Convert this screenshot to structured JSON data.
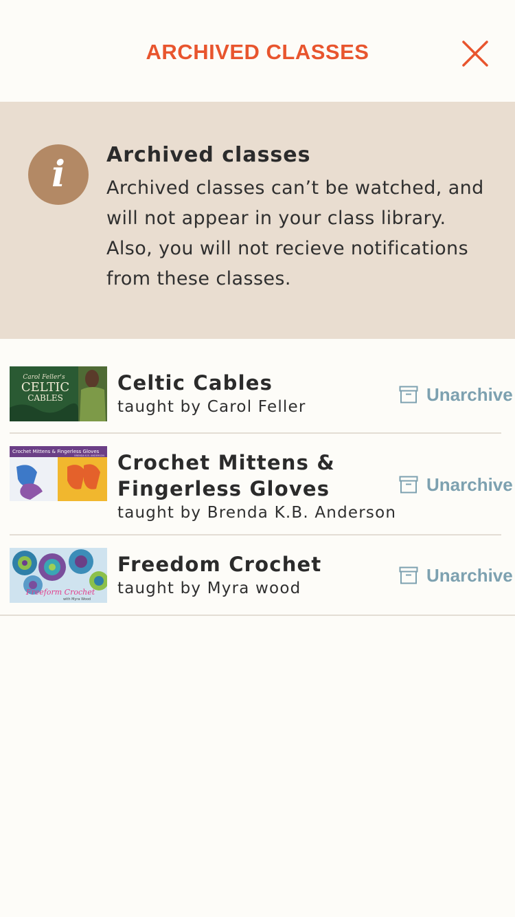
{
  "header": {
    "title": "ARCHIVED CLASSES",
    "close_icon": "close-icon",
    "accent_color": "#e8552e"
  },
  "info": {
    "icon": "info-icon",
    "icon_glyph": "i",
    "title": "Archived classes",
    "body": "Archived classes can’t be watched, and will not appear in your class library. Also, you will not recieve notifications from these classes.",
    "background": "#e9ddd0"
  },
  "classes": [
    {
      "title": "Celtic Cables",
      "teacher": "taught by Carol Feller",
      "action": "Unarchive",
      "thumbnail_text": [
        "Carol Feller's",
        "CELTIC",
        "CABLES"
      ]
    },
    {
      "title": "Crochet Mittens & Fingerless Gloves",
      "teacher": "taught by Brenda K.B. Anderson",
      "action": "Unarchive",
      "thumbnail_text": [
        "Crochet Mittens & Fingerless Gloves",
        "BRENDA K.B. ANDERSON"
      ]
    },
    {
      "title": "Freedom Crochet",
      "teacher": "taught by Myra wood",
      "action": "Unarchive",
      "thumbnail_text": [
        "Freeform Crochet",
        "with Myra Wood"
      ]
    }
  ],
  "action_color": "#7da1b0",
  "action_icon": "archive-box-icon"
}
